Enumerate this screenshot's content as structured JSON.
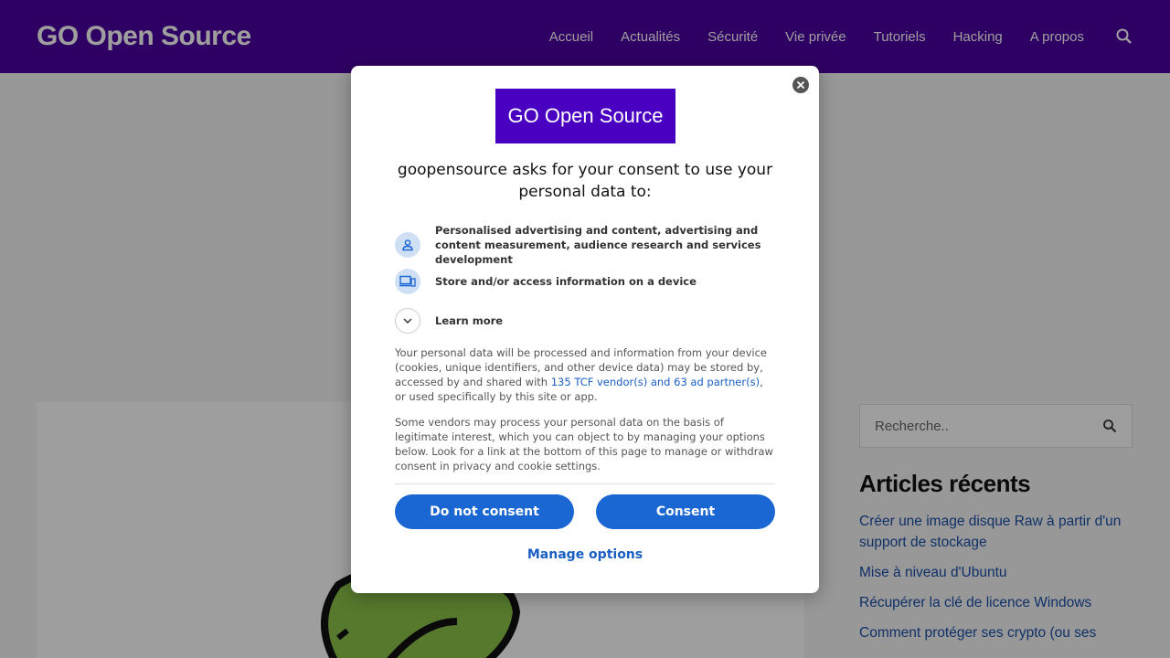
{
  "header": {
    "site_title": "GO Open Source",
    "nav": [
      "Accueil",
      "Actualités",
      "Sécurité",
      "Vie privée",
      "Tutoriels",
      "Hacking",
      "A propos"
    ],
    "search_icon": "search-icon"
  },
  "sidebar": {
    "search_placeholder": "Recherche..",
    "recent_title": "Articles récents",
    "recent_items": [
      "Créer une image disque Raw à partir d'un support de stockage",
      "Mise à niveau d'Ubuntu",
      "Récupérer la clé de licence Windows",
      "Comment protéger ses crypto (ou ses"
    ]
  },
  "dialog": {
    "logo_text": "GO Open Source",
    "title": "goopensource asks for your consent to use your personal data to:",
    "purposes": [
      {
        "icon": "person-icon",
        "text": "Personalised advertising and content, advertising and content measurement, audience research and services development"
      },
      {
        "icon": "devices-icon",
        "text": "Store and/or access information on a device"
      }
    ],
    "learn_more": "Learn more",
    "para1_pre": "Your personal data will be processed and information from your device (cookies, unique identifiers, and other device data) may be stored by, accessed by and shared with ",
    "para1_link": "135 TCF vendor(s) and 63 ad partner(s)",
    "para1_post": ", or used specifically by this site or app.",
    "para2": "Some vendors may process your personal data on the basis of legitimate interest, which you can object to by managing your options below. Look for a link at the bottom of this page to manage or withdraw consent in privacy and cookie settings.",
    "do_not_consent": "Do not consent",
    "consent": "Consent",
    "manage_options": "Manage options"
  },
  "colors": {
    "header_bg": "#4b00a0",
    "logo_bg": "#4a00c0",
    "button_bg": "#1a66d2",
    "link": "#1a5fc4"
  }
}
